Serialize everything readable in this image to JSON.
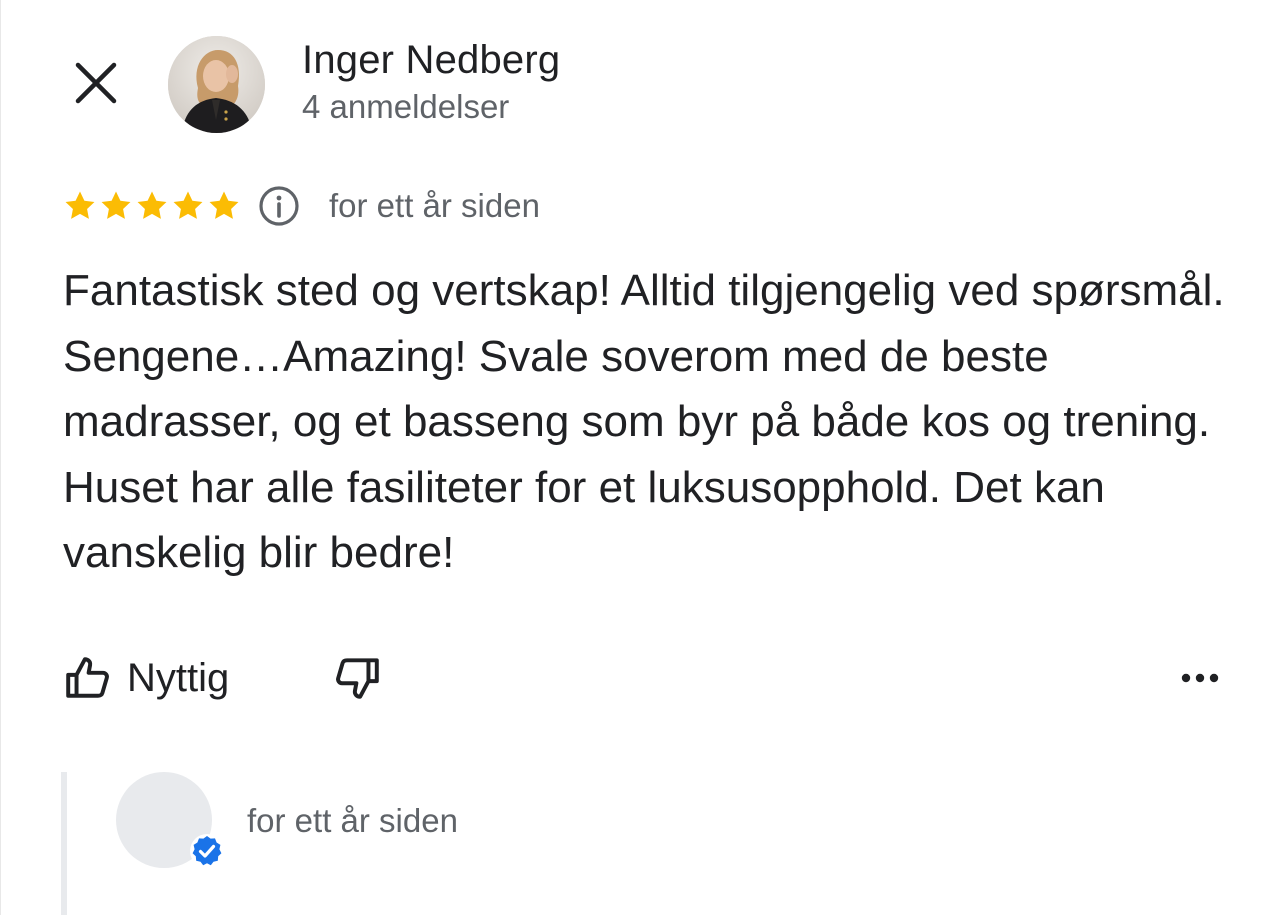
{
  "reviewer": {
    "name": "Inger Nedberg",
    "review_count": "4 anmeldelser"
  },
  "review": {
    "rating": 5,
    "max_rating": 5,
    "date": "for ett år siden",
    "text": "Fantastisk sted og vertskap! Alltid tilgjengelig ved spørsmål. Sengene…Amazing! Svale soverom med de beste madrasser, og et basseng som byr på både kos og trening. Huset har alle fasiliteter for et luksusopphold. Det kan vanskelig blir bedre!"
  },
  "actions": {
    "helpful_label": "Nyttig"
  },
  "owner_reply": {
    "date": "for ett år siden"
  },
  "icons": {
    "close": "close-icon",
    "info": "info-icon",
    "star": "star-icon",
    "thumbs_up": "thumbs-up-icon",
    "thumbs_down": "thumbs-down-icon",
    "more": "more-horizontal-icon",
    "verified": "verified-badge-icon"
  },
  "colors": {
    "star": "#fbbc04",
    "text_primary": "#202124",
    "text_secondary": "#5f6368",
    "verified": "#1a73e8",
    "reply_border": "#e8eaed"
  }
}
